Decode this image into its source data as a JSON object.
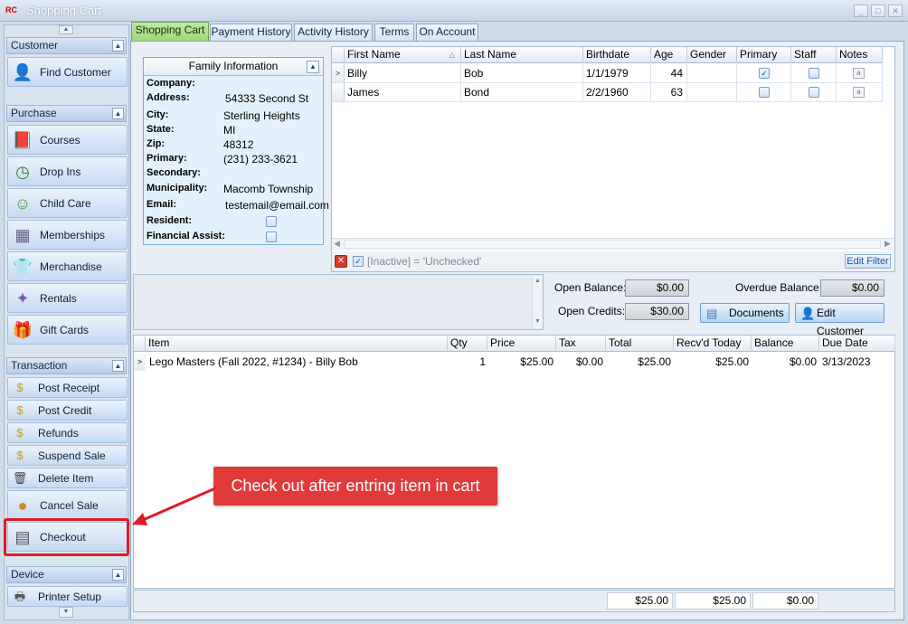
{
  "window": {
    "title": "Shopping Cart",
    "logo": "RC"
  },
  "sidebar": {
    "groups": [
      {
        "label": "Customer",
        "items": [
          {
            "label": "Find Customer",
            "icon": "person-icon"
          }
        ]
      },
      {
        "label": "Purchase",
        "items": [
          {
            "label": "Courses",
            "icon": "book-icon"
          },
          {
            "label": "Drop Ins",
            "icon": "clock-icon"
          },
          {
            "label": "Child Care",
            "icon": "child-icon"
          },
          {
            "label": "Memberships",
            "icon": "membership-card-icon"
          },
          {
            "label": "Merchandise",
            "icon": "shirt-icon"
          },
          {
            "label": "Rentals",
            "icon": "rental-icon"
          },
          {
            "label": "Gift Cards",
            "icon": "gift-icon"
          }
        ]
      },
      {
        "label": "Transaction",
        "items": [
          {
            "label": "Post Receipt",
            "icon": "receipt-icon"
          },
          {
            "label": "Post Credit",
            "icon": "credit-icon"
          },
          {
            "label": "Refunds",
            "icon": "refund-icon"
          },
          {
            "label": "Suspend Sale",
            "icon": "suspend-icon"
          },
          {
            "label": "Delete Item",
            "icon": "delete-icon"
          },
          {
            "label": "Cancel Sale",
            "icon": "cancel-sale-icon"
          },
          {
            "label": "Checkout",
            "icon": "register-icon"
          }
        ]
      },
      {
        "label": "Device",
        "items": [
          {
            "label": "Printer Setup",
            "icon": "printer-icon"
          }
        ]
      }
    ]
  },
  "tabs": [
    "Shopping Cart",
    "Payment History",
    "Activity History",
    "Terms",
    "On Account"
  ],
  "family": {
    "title": "Family Information",
    "fields": [
      {
        "label": "Company:",
        "value": ""
      },
      {
        "label": "Address:",
        "value": "54333 Second St"
      },
      {
        "label": "City:",
        "value": "Sterling Heights"
      },
      {
        "label": "State:",
        "value": "MI"
      },
      {
        "label": "Zip:",
        "value": "48312"
      },
      {
        "label": "Primary:",
        "value": "(231) 233-3621"
      },
      {
        "label": "Secondary:",
        "value": ""
      },
      {
        "label": "Municipality:",
        "value": "Macomb Township"
      },
      {
        "label": "Email:",
        "value": "testemail@email.com"
      },
      {
        "label": "Resident:",
        "value": ""
      },
      {
        "label": "Financial Assist:",
        "value": ""
      }
    ]
  },
  "customers": {
    "headers": [
      "First Name",
      "Last Name",
      "Birthdate",
      "Age",
      "Gender",
      "Primary",
      "Staff",
      "Notes"
    ],
    "rows": [
      {
        "first": "Billy",
        "last": "Bob",
        "birthdate": "1/1/1979",
        "age": "44",
        "gender": "",
        "primary": true,
        "staff": false
      },
      {
        "first": "James",
        "last": "Bond",
        "birthdate": "2/2/1960",
        "age": "63",
        "gender": "",
        "primary": false,
        "staff": false
      }
    ],
    "filter_text": "[Inactive] = 'Unchecked'",
    "edit_filter_label": "Edit Filter"
  },
  "balances": {
    "open_balance_label": "Open Balance:",
    "open_balance": "$0.00",
    "overdue_label": "Overdue Balance:",
    "overdue": "$0.00",
    "open_credits_label": "Open Credits:",
    "open_credits": "$30.00",
    "documents_label": "Documents",
    "edit_customer_label": "Edit Customer"
  },
  "cart": {
    "headers": [
      "Item",
      "Qty",
      "Price",
      "Tax",
      "Total",
      "Recv'd Today",
      "Balance",
      "Due Date"
    ],
    "rows": [
      {
        "item": "Lego Masters (Fall  2022, #1234) - Billy Bob",
        "qty": "1",
        "price": "$25.00",
        "tax": "$0.00",
        "total": "$25.00",
        "recvd": "$25.00",
        "balance": "$0.00",
        "due": "3/13/2023"
      }
    ],
    "totals": {
      "total": "$25.00",
      "recvd": "$25.00",
      "balance": "$0.00"
    }
  },
  "annotation": {
    "text": "Check out after entring item in cart",
    "color": "#e13a3a"
  }
}
